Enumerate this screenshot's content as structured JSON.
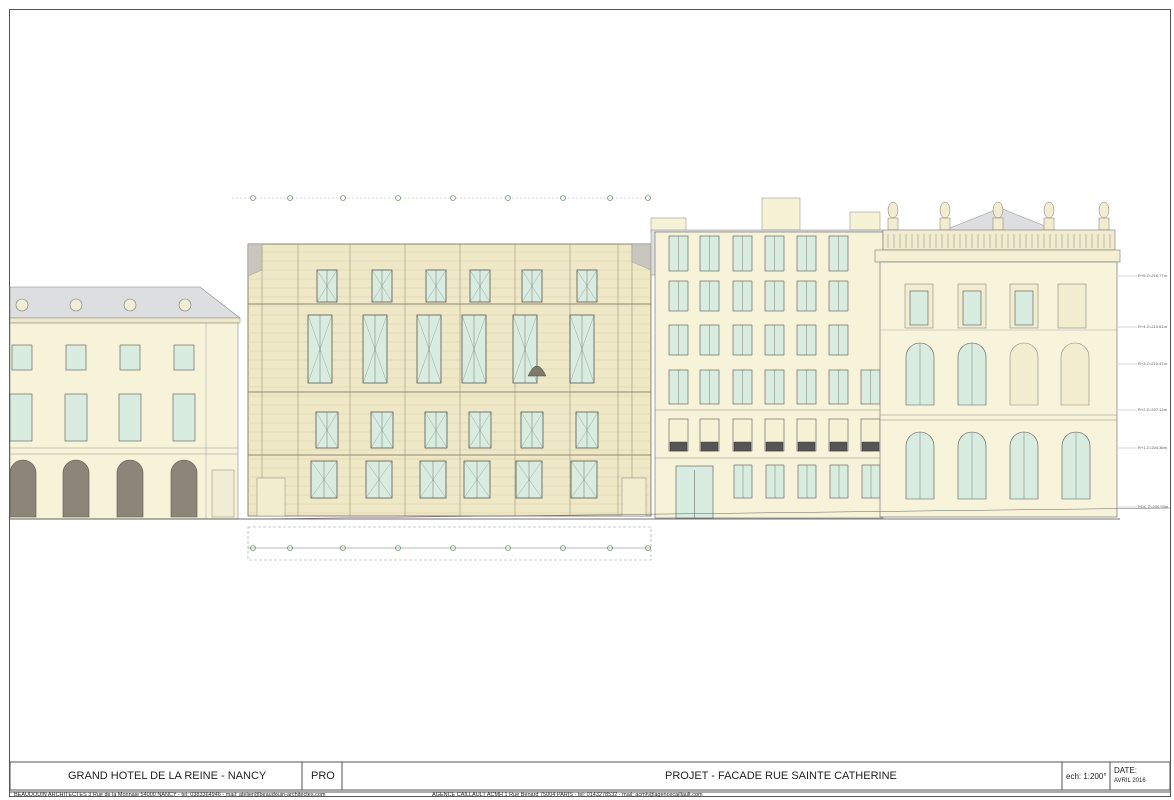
{
  "title_block": {
    "project_name": "GRAND HOTEL DE LA REINE  -  NANCY",
    "phase": "PRO",
    "sheet_title": "PROJET - FACADE RUE SAINTE CATHERINE",
    "scale": "ech: 1:200°",
    "date_label": "DATE:",
    "date_value": "AVRIL 2016"
  },
  "footer": {
    "architect_1": "BEAUDOUIN ARCHITECTES    3 Rue de la Monnaie 54000 NANCY - tel: 0383364946 - mail: atelier@beaudouin-architectes.com",
    "architect_2": "AGENCE CAILLAULT ACMH    1 Rue Bénard 75004 PARIS - tel: 0143278532 - mail: acmh@agencecaillault.com"
  },
  "levels": [
    {
      "label": "R+5 Z=218.77m"
    },
    {
      "label": "R+4 Z=213.61m"
    },
    {
      "label": "R+3 Z=210.47m"
    },
    {
      "label": "R+2 Z=207.12m"
    },
    {
      "label": "R+1 Z=204.36m"
    },
    {
      "label": "RDC Z=200.93m"
    }
  ],
  "colors": {
    "facade_cream": "#f6f2d6",
    "stone": "#ece4c0",
    "glass": "#d8ecdf",
    "roof": "#d9dbdc",
    "line": "#6f6a55",
    "grid_green": "#3b8a3b"
  }
}
